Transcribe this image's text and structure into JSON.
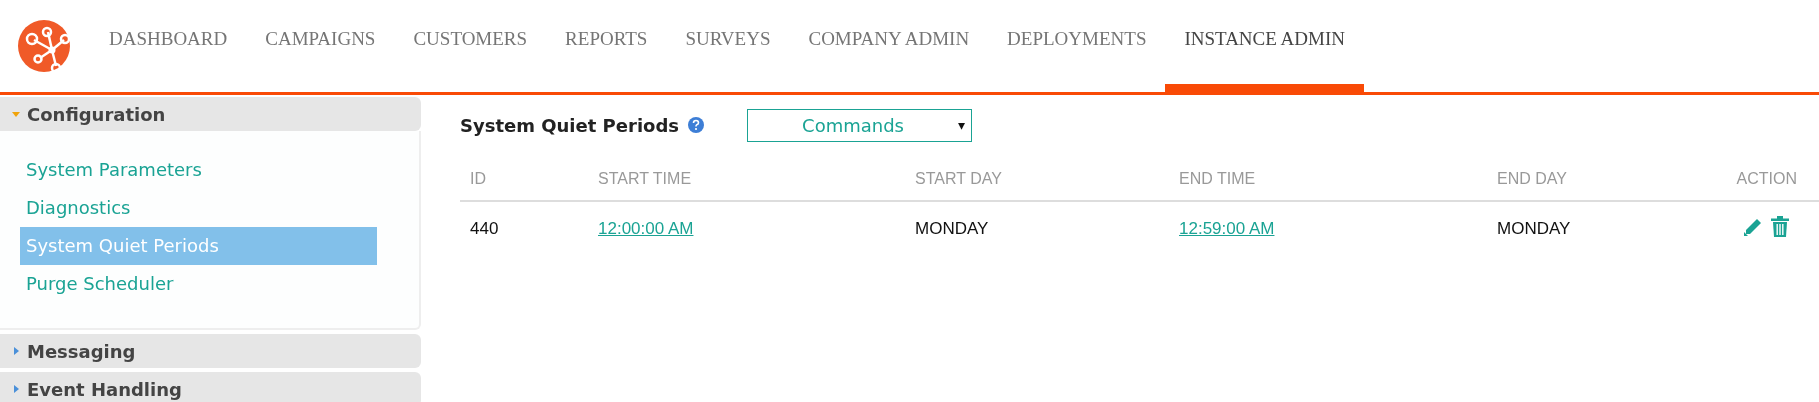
{
  "nav": {
    "items": [
      {
        "label": "DASHBOARD",
        "selected": false
      },
      {
        "label": "CAMPAIGNS",
        "selected": false
      },
      {
        "label": "CUSTOMERS",
        "selected": false
      },
      {
        "label": "REPORTS",
        "selected": false
      },
      {
        "label": "SURVEYS",
        "selected": false
      },
      {
        "label": "COMPANY ADMIN",
        "selected": false
      },
      {
        "label": "DEPLOYMENTS",
        "selected": false
      },
      {
        "label": "INSTANCE ADMIN",
        "selected": true
      }
    ]
  },
  "sidebar": {
    "sections": [
      {
        "title": "Configuration",
        "expanded": true,
        "items": [
          {
            "label": "System Parameters",
            "selected": false
          },
          {
            "label": "Diagnostics",
            "selected": false
          },
          {
            "label": "System Quiet Periods",
            "selected": true
          },
          {
            "label": "Purge Scheduler",
            "selected": false
          }
        ]
      },
      {
        "title": "Messaging",
        "expanded": false
      },
      {
        "title": "Event Handling",
        "expanded": false
      }
    ]
  },
  "page": {
    "title": "System Quiet Periods",
    "commands": {
      "value": "Commands",
      "caret": "▾"
    }
  },
  "table": {
    "columns": [
      "ID",
      "START TIME",
      "START DAY",
      "END TIME",
      "END DAY",
      "ACTION"
    ],
    "rows": [
      {
        "id": "440",
        "start_time": "12:00:00 AM",
        "start_day": "MONDAY",
        "end_time": "12:59:00 AM",
        "end_day": "MONDAY"
      }
    ]
  }
}
